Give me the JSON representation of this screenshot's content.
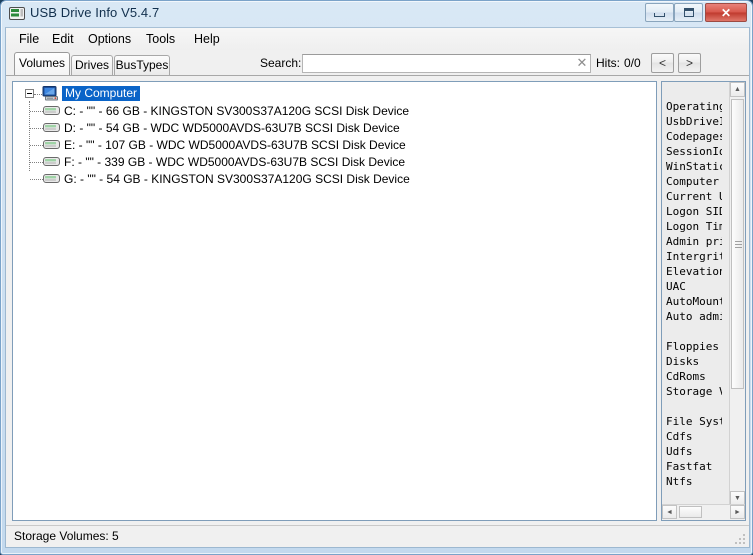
{
  "window": {
    "title": "USB Drive Info V5.4.7",
    "icon": "drive-icon",
    "buttons": {
      "minimize": "minimize-button",
      "maximize": "maximize-button",
      "close": "✕"
    }
  },
  "menu": [
    {
      "label": "File"
    },
    {
      "label": "Edit"
    },
    {
      "label": "Options"
    },
    {
      "label": "Tools"
    },
    {
      "label": "Help"
    }
  ],
  "tabs": [
    {
      "label": "Volumes",
      "selected": true
    },
    {
      "label": "Drives",
      "selected": false
    },
    {
      "label": "BusTypes",
      "selected": false
    }
  ],
  "search": {
    "label": "Search:",
    "value": "",
    "placeholder": "",
    "clear_icon": "✕",
    "hits_label": "Hits:",
    "hits_value": "0/0",
    "prev_label": "<",
    "next_label": ">"
  },
  "tree": {
    "root": {
      "label": "My Computer",
      "icon": "my-computer-icon",
      "expanded": true,
      "selected": true
    },
    "drives": [
      {
        "letter": "C:",
        "volume_label": "\"\"",
        "size": "66 GB",
        "model": "KINGSTON SV300S37A120G SCSI Disk Device",
        "text": "C: - \"\" - 66 GB - KINGSTON SV300S37A120G SCSI Disk Device"
      },
      {
        "letter": "D:",
        "volume_label": "\"\"",
        "size": "54 GB",
        "model": "WDC WD5000AVDS-63U7B SCSI Disk Device",
        "text": "D: - \"\" - 54 GB - WDC WD5000AVDS-63U7B SCSI Disk Device"
      },
      {
        "letter": "E:",
        "volume_label": "\"\"",
        "size": "107 GB",
        "model": "WDC WD5000AVDS-63U7B SCSI Disk Device",
        "text": "E: - \"\" - 107 GB - WDC WD5000AVDS-63U7B SCSI Disk Device"
      },
      {
        "letter": "F:",
        "volume_label": "\"\"",
        "size": "339 GB",
        "model": "WDC WD5000AVDS-63U7B SCSI Disk Device",
        "text": "F: - \"\" - 339 GB - WDC WD5000AVDS-63U7B SCSI Disk Device"
      },
      {
        "letter": "G:",
        "volume_label": "\"\"",
        "size": "54 GB",
        "model": "KINGSTON SV300S37A120G SCSI Disk Device",
        "text": "G: - \"\" - 54 GB - KINGSTON SV300S37A120G SCSI Disk Device"
      }
    ]
  },
  "info_panel": {
    "text": "         ===\nOperating\nUsbDriveI\nCodepages\nSessionId\nWinStatic\nComputer\nCurrent U\nLogon SID\nLogon Tim\nAdmin pri\nIntergrit\nElevation\nUAC\nAutoMount\nAuto admi\n\nFloppies\nDisks\nCdRoms\nStorage V\n\nFile Syst\nCdfs\nUdfs\nFastfat\nNtfs",
    "scroll_up": "▲",
    "scroll_down": "▼",
    "scroll_left": "◄",
    "scroll_right": "►"
  },
  "status": {
    "text": "Storage Volumes: 5"
  },
  "colors": {
    "selection": "#0a64c8",
    "window_frame": "#7ba3c9",
    "close_button": "#bf3a2e",
    "panel_border": "#7f9db9"
  }
}
